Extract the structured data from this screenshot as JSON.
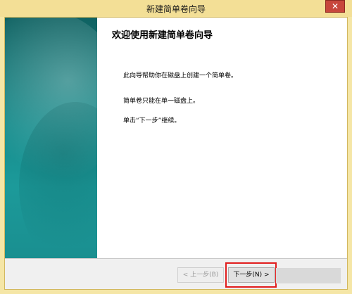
{
  "window": {
    "title": "新建简单卷向导",
    "close_glyph": "✕"
  },
  "content": {
    "heading": "欢迎使用新建简单卷向导",
    "paragraphs": [
      "此向导帮助你在磁盘上创建一个简单卷。",
      "简单卷只能在单一磁盘上。",
      "单击“下一步”继续。"
    ]
  },
  "footer": {
    "back_label": "< 上一步(B)",
    "next_label": "下一步(N) >"
  },
  "colors": {
    "title_bar": "#f3df96",
    "side_panel": "#168c8c",
    "highlight": "#e11d1d"
  }
}
